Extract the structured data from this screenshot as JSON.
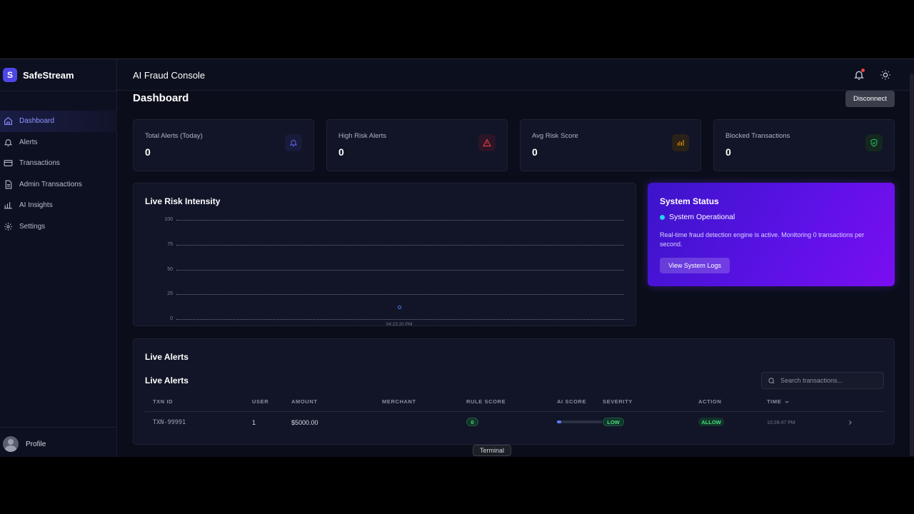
{
  "brand": {
    "logo_letter": "S",
    "name": "SafeStream"
  },
  "sidebar": {
    "items": [
      {
        "label": "Dashboard",
        "icon": "home-icon",
        "active": true
      },
      {
        "label": "Alerts",
        "icon": "bell-icon"
      },
      {
        "label": "Transactions",
        "icon": "credit-card-icon"
      },
      {
        "label": "Admin Transactions",
        "icon": "document-icon"
      },
      {
        "label": "AI Insights",
        "icon": "bar-chart-icon"
      },
      {
        "label": "Settings",
        "icon": "gear-icon"
      }
    ],
    "profile_label": "Profile"
  },
  "header": {
    "title": "AI Fraud Console"
  },
  "main": {
    "page_title": "Dashboard",
    "disconnect_label": "Disconnect"
  },
  "stats": [
    {
      "label": "Total Alerts (Today)",
      "value": "0",
      "icon": "bell-icon",
      "color": "#6366f1"
    },
    {
      "label": "High Risk Alerts",
      "value": "0",
      "icon": "warning-icon",
      "color": "#ef4444"
    },
    {
      "label": "Avg Risk Score",
      "value": "0",
      "icon": "bar-chart-icon",
      "color": "#f59e0b"
    },
    {
      "label": "Blocked Transactions",
      "value": "0",
      "icon": "shield-check-icon",
      "color": "#22c55e"
    }
  ],
  "chart": {
    "title": "Live Risk Intensity"
  },
  "chart_data": {
    "type": "scatter",
    "title": "Live Risk Intensity",
    "xlabel": "",
    "ylabel": "",
    "yticks": [
      100,
      75,
      50,
      25,
      0
    ],
    "ylim": [
      0,
      100
    ],
    "x": [
      "04:23:20 PM"
    ],
    "values": [
      12
    ],
    "grid": true
  },
  "system_status": {
    "title": "System Status",
    "status": "System Operational",
    "description": "Real-time fraud detection engine is active. Monitoring 0 transactions per second.",
    "button_label": "View System Logs"
  },
  "alerts": {
    "section_title": "Live Alerts",
    "table_title": "Live Alerts",
    "search_placeholder": "Search transactions...",
    "columns": [
      "TXN ID",
      "USER",
      "AMOUNT",
      "MERCHANT",
      "RULE SCORE",
      "AI SCORE",
      "SEVERITY",
      "ACTION",
      "TIME"
    ],
    "rows": [
      {
        "txn_id": "TXN-99991",
        "user": "1",
        "amount": "$5000.00",
        "merchant": "",
        "rule_score": "0",
        "ai_score": 0.1,
        "severity": "LOW",
        "action": "ALLOW",
        "time": "10:28:47 PM"
      }
    ]
  },
  "terminal_label": "Terminal"
}
